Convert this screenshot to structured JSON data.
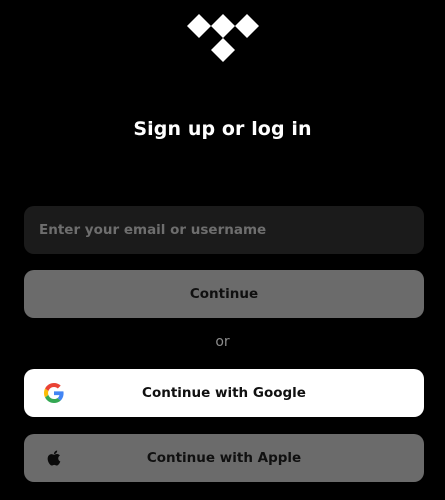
{
  "brand": {
    "logo_icon": "tidal-logo-icon",
    "logo_color": "#ffffff"
  },
  "page": {
    "title": "Sign up or log in",
    "background": "#000000"
  },
  "email": {
    "placeholder": "Enter your email or username",
    "value": ""
  },
  "continue_button": {
    "label": "Continue",
    "color": "#6b6b6b"
  },
  "divider": {
    "label": "or"
  },
  "google_button": {
    "label": "Continue with Google",
    "icon": "google-icon",
    "color": "#ffffff"
  },
  "apple_button": {
    "label": "Continue with Apple",
    "icon": "apple-icon",
    "color": "#6b6b6b"
  }
}
